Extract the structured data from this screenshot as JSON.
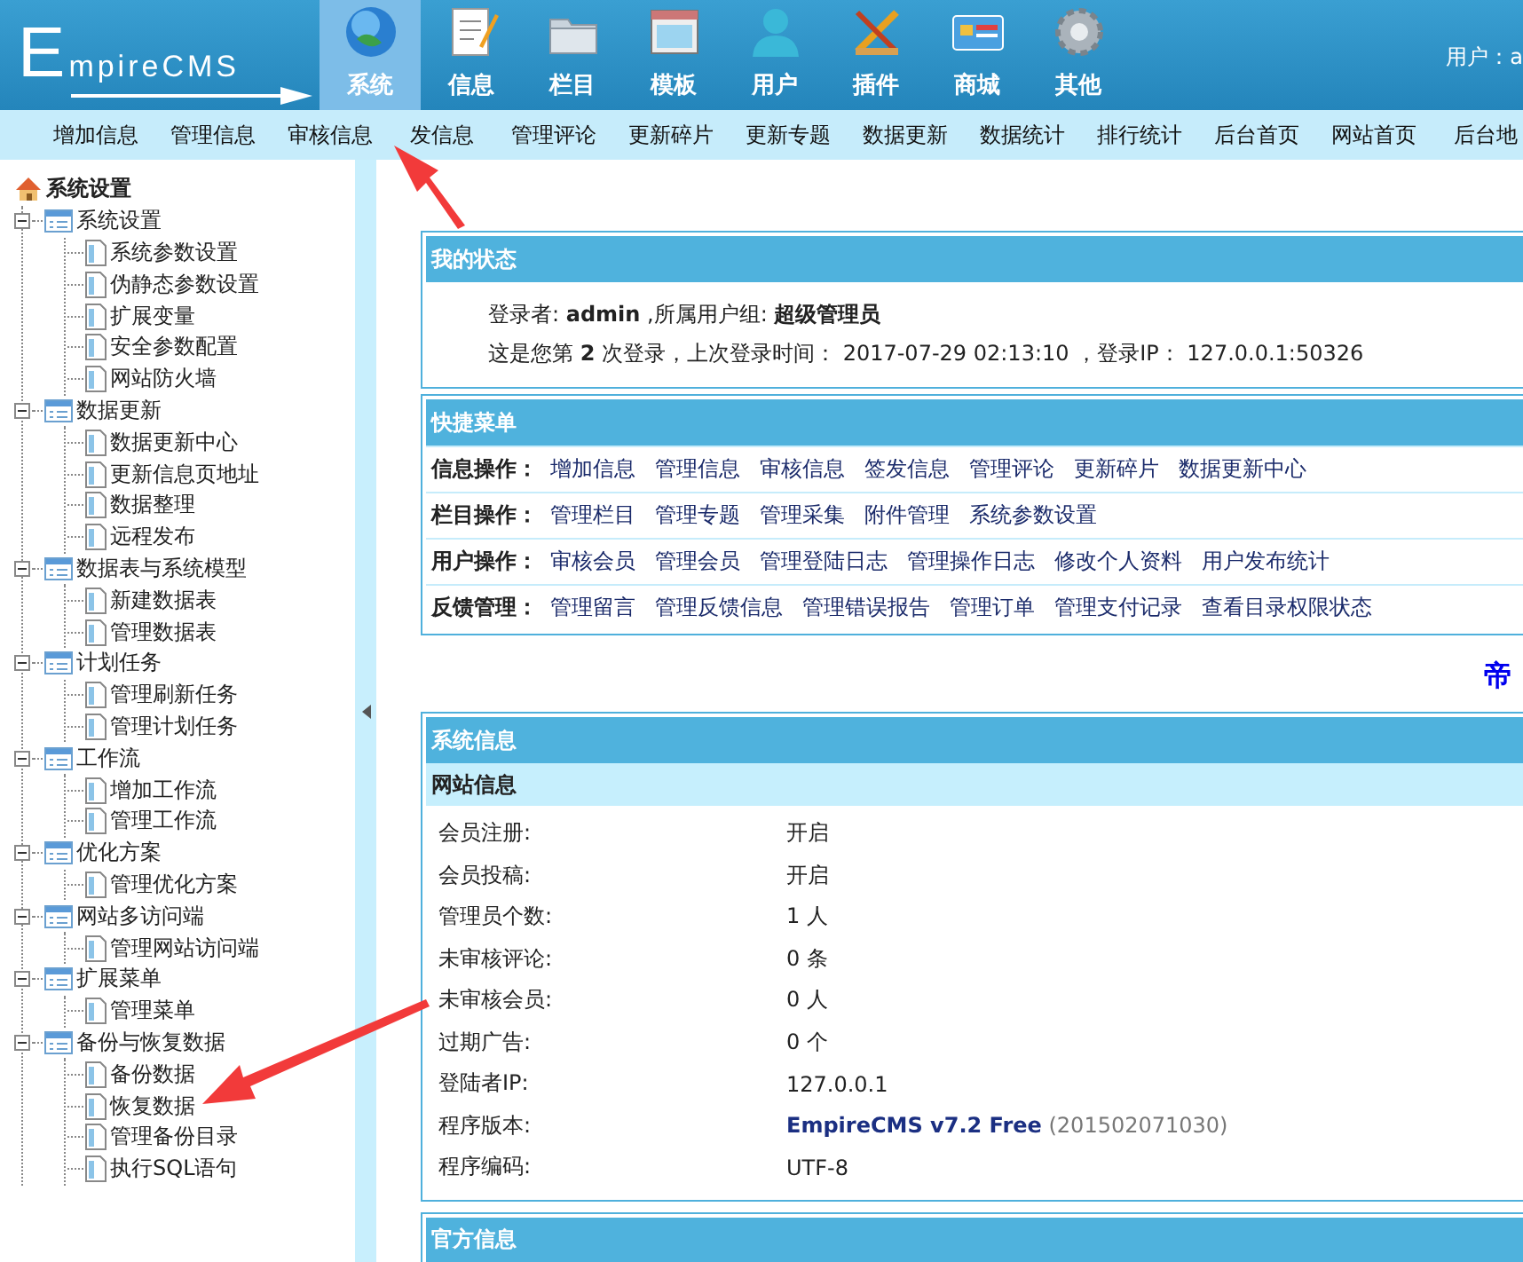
{
  "header": {
    "logo": "EmpireCMS",
    "user_label": "用户：a"
  },
  "top_menu": [
    {
      "label": "系统",
      "selected": true
    },
    {
      "label": "信息",
      "selected": false
    },
    {
      "label": "栏目",
      "selected": false
    },
    {
      "label": "模板",
      "selected": false
    },
    {
      "label": "用户",
      "selected": false
    },
    {
      "label": "插件",
      "selected": false
    },
    {
      "label": "商城",
      "selected": false
    },
    {
      "label": "其他",
      "selected": false
    }
  ],
  "sub_menu": [
    "增加信息",
    "管理信息",
    "审核信息",
    "发信息",
    "管理评论",
    "更新碎片",
    "更新专题",
    "数据更新",
    "数据统计",
    "排行统计",
    "后台首页",
    "网站首页",
    "后台地"
  ],
  "sidebar": {
    "title": "系统设置",
    "groups": [
      {
        "label": "系统设置",
        "expanded": true,
        "children": [
          "系统参数设置",
          "伪静态参数设置",
          "扩展变量",
          "安全参数配置",
          "网站防火墙"
        ]
      },
      {
        "label": "数据更新",
        "expanded": true,
        "children": [
          "数据更新中心",
          "更新信息页地址",
          "数据整理",
          "远程发布"
        ]
      },
      {
        "label": "数据表与系统模型",
        "expanded": true,
        "children": [
          "新建数据表",
          "管理数据表"
        ]
      },
      {
        "label": "计划任务",
        "expanded": true,
        "children": [
          "管理刷新任务",
          "管理计划任务"
        ]
      },
      {
        "label": "工作流",
        "expanded": true,
        "children": [
          "增加工作流",
          "管理工作流"
        ]
      },
      {
        "label": "优化方案",
        "expanded": true,
        "children": [
          "管理优化方案"
        ]
      },
      {
        "label": "网站多访问端",
        "expanded": true,
        "children": [
          "管理网站访问端"
        ]
      },
      {
        "label": "扩展菜单",
        "expanded": true,
        "children": [
          "管理菜单"
        ]
      },
      {
        "label": "备份与恢复数据",
        "expanded": true,
        "children": [
          "备份数据",
          "恢复数据",
          "管理备份目录",
          "执行SQL语句"
        ]
      }
    ]
  },
  "status_panel": {
    "title": "我的状态",
    "lines": [
      "登录者: **admin**  ,所属用户组: **超级管理员**",
      "这是您第 **2** 次登录，上次登录时间： 2017-07-29 02:13:10 ，登录IP： 127.0.0.1:50326"
    ]
  },
  "quick_menu": {
    "title": "快捷菜单",
    "rows": [
      {
        "label": "信息操作：",
        "links": [
          "增加信息",
          "管理信息",
          "审核信息",
          "签发信息",
          "管理评论",
          "更新碎片",
          "数据更新中心"
        ]
      },
      {
        "label": "栏目操作：",
        "links": [
          "管理栏目",
          "管理专题",
          "管理采集",
          "附件管理",
          "系统参数设置"
        ]
      },
      {
        "label": "用户操作：",
        "links": [
          "审核会员",
          "管理会员",
          "管理登陆日志",
          "管理操作日志",
          "修改个人资料",
          "用户发布统计"
        ]
      },
      {
        "label": "反馈管理：",
        "links": [
          "管理留言",
          "管理反馈信息",
          "管理错误报告",
          "管理订单",
          "管理支付记录",
          "查看目录权限状态"
        ]
      }
    ]
  },
  "banner_text": "帝",
  "system_info": {
    "title": "系统信息",
    "subtitle": "网站信息",
    "rows": [
      {
        "label": "会员注册:",
        "value": "开启",
        "kind": "plain"
      },
      {
        "label": "会员投稿:",
        "value": "开启",
        "kind": "plain"
      },
      {
        "label": "管理员个数:",
        "value": "1 人",
        "kind": "plain"
      },
      {
        "label": "未审核评论:",
        "value": "0 条",
        "kind": "plain"
      },
      {
        "label": "未审核会员:",
        "value": "0 人",
        "kind": "plain"
      },
      {
        "label": "过期广告:",
        "value": "0 个",
        "kind": "plain"
      },
      {
        "label": "登陆者IP:",
        "value": "127.0.0.1",
        "kind": "plain"
      },
      {
        "label": "程序版本:",
        "value": "**EmpireCMS v7.2 Free** (201502071030)",
        "kind": "version"
      },
      {
        "label": "程序编码:",
        "value": "UTF-8",
        "kind": "plain"
      }
    ]
  },
  "official_panel": {
    "title": "官方信息"
  }
}
